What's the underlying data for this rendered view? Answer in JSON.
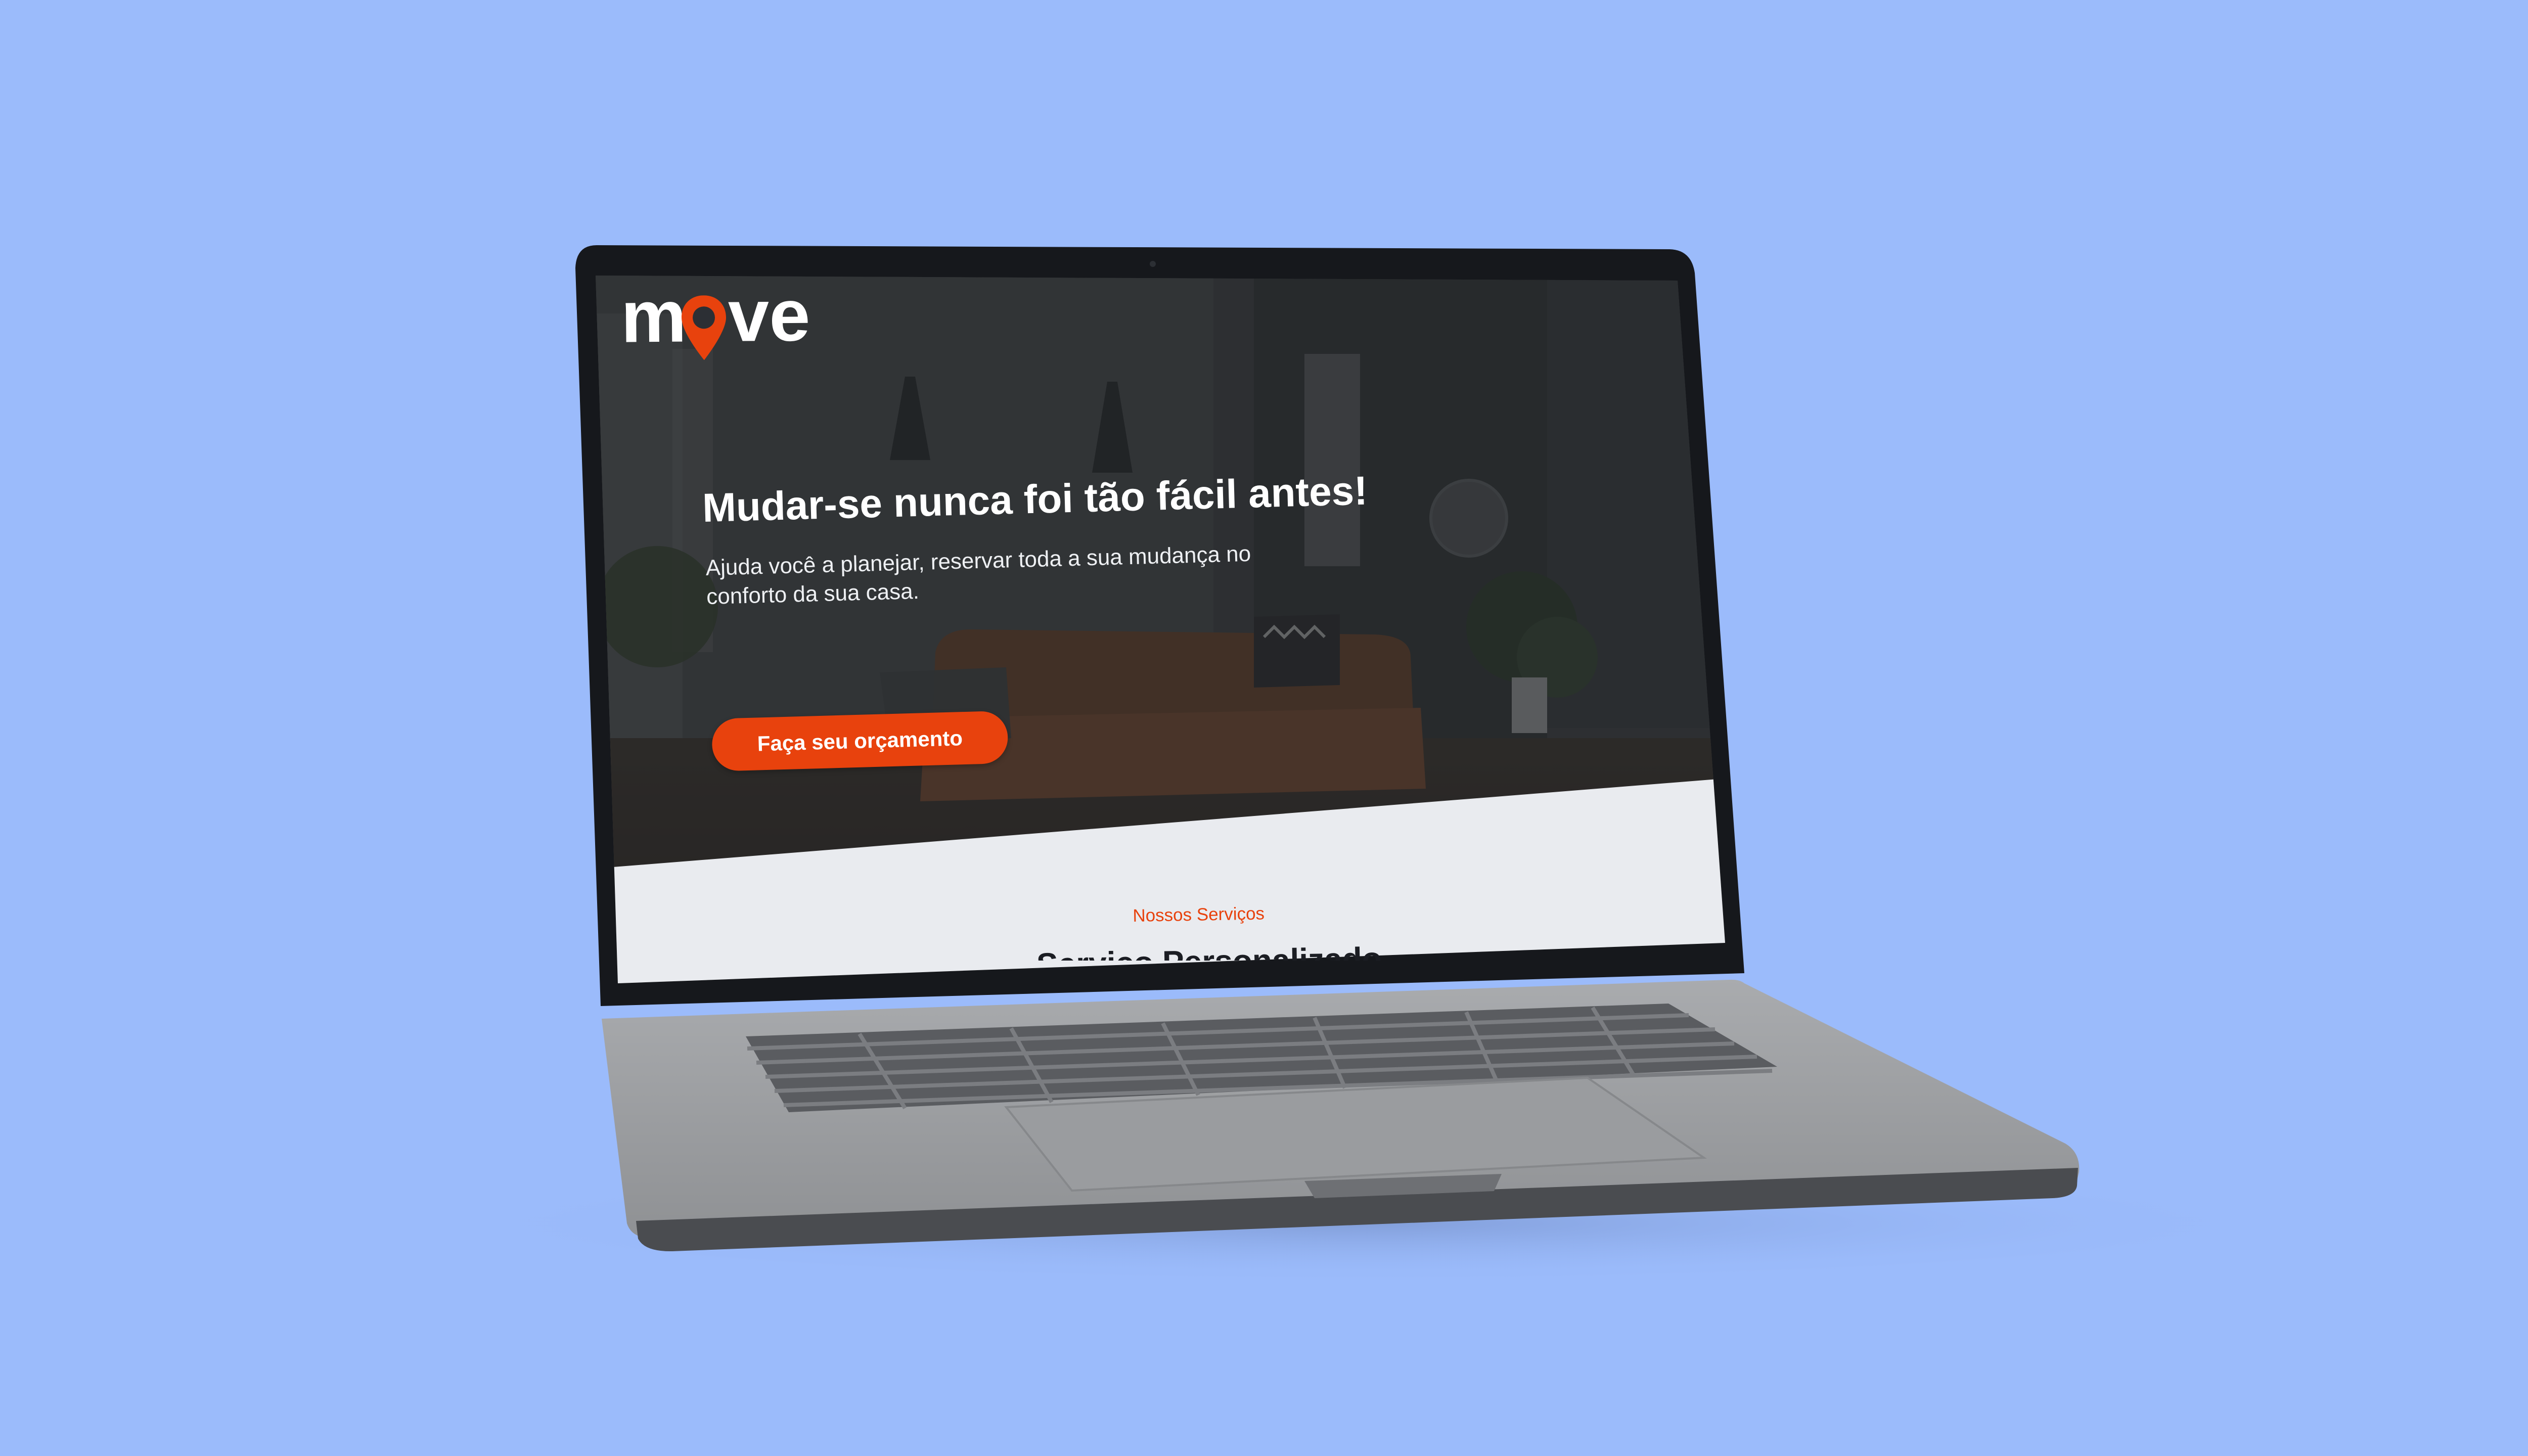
{
  "device": {
    "type": "laptop",
    "colors": {
      "background": "#9bbbfb",
      "bezel": "#16181c",
      "aluminium": "#9ea0a3",
      "keyboard": "#5a5c60"
    }
  },
  "site": {
    "brand": {
      "letters_before": "m",
      "letters_after": "ve",
      "pin_icon": "map-pin-icon",
      "accent": "#e8420d"
    },
    "hero": {
      "headline": "Mudar-se nunca foi tão fácil antes!",
      "subtitle": "Ajuda você a planejar, reservar toda a sua mudança no conforto da sua casa.",
      "cta_label": "Faça seu orçamento",
      "overlay_color": "#2c2f34"
    },
    "services": {
      "eyebrow": "Nossos Serviços",
      "title": "Serviço Personalizado",
      "background": "#e9ebef"
    }
  }
}
